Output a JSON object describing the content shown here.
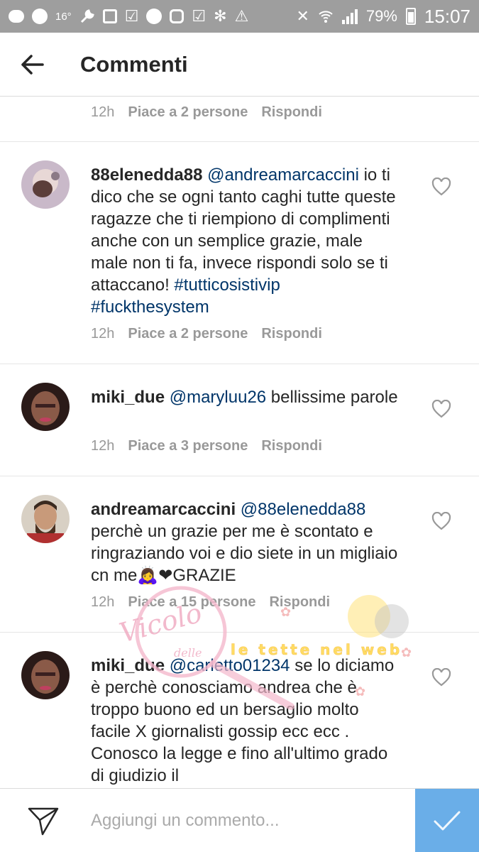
{
  "status_bar": {
    "temperature": "16°",
    "battery": "79%",
    "time": "15:07"
  },
  "header": {
    "title": "Commenti",
    "back_icon": "arrow-left-icon"
  },
  "previous_comment_meta": {
    "time": "12h",
    "likes": "Piace a 2 persone",
    "reply": "Rispondi"
  },
  "comments": [
    {
      "username": "88elenedda88",
      "mention": "@andreamarcaccini",
      "text": " io ti dico che se ogni tanto caghi tutte queste ragazze che ti riempiono di complimenti anche con un semplice grazie, male male non ti fa, invece rispondi solo se ti attaccano! ",
      "hashtags": "#tutticosistivip #fuckthesystem",
      "time": "12h",
      "likes": "Piace a 2 persone",
      "reply": "Rispondi"
    },
    {
      "username": "miki_due",
      "mention": "@maryluu26",
      "text": " bellissime parole",
      "hashtags": "",
      "time": "12h",
      "likes": "Piace a 3 persone",
      "reply": "Rispondi"
    },
    {
      "username": "andreamarcaccini",
      "mention": "@88elenedda88",
      "text": " perchè un grazie per me è scontato e ringraziando voi e dio siete in un migliaio cn me🙇‍♀️❤GRAZIE",
      "hashtags": "",
      "time": "12h",
      "likes": "Piace a 15 persone",
      "reply": "Rispondi"
    },
    {
      "username": "miki_due",
      "mention": "@carletto01234",
      "text": " se lo diciamo è perchè conosciamo andrea che è troppo buono ed un bersaglio molto facile X giornalisti gossip ecc ecc . Conosco la legge e fino all'ultimo grado di giudizio il",
      "hashtags": "",
      "time": "",
      "likes": "",
      "reply": ""
    }
  ],
  "composer": {
    "placeholder": "Aggiungi un commento...",
    "send_icon": "send-icon",
    "submit_icon": "checkmark-icon"
  },
  "watermark": {
    "text_left": "Vicolo delle",
    "text_right": "le tette nel web"
  },
  "colors": {
    "status_bar": "#9e9e9e",
    "mention": "#003569",
    "meta": "#999999",
    "submit": "#6aaee8"
  }
}
